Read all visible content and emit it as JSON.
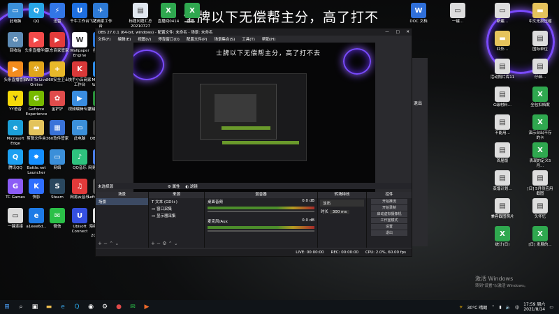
{
  "overlay": {
    "banner": "士牌以下无偿帮主分，高了打不",
    "banner_inner": "士牌以下无偿帮主分，高了打不去"
  },
  "desktop_left": [
    {
      "label": "此电脑",
      "color": "#3b8fd9",
      "glyph": "▭"
    },
    {
      "label": "QQ",
      "color": "#28a6e8",
      "glyph": "Q"
    },
    {
      "label": "迅雷",
      "color": "#3276e6",
      "glyph": "⚡"
    },
    {
      "label": "千牛工作台",
      "color": "#1e6fe0",
      "glyph": "U"
    },
    {
      "label": "飞猪商家工作台",
      "color": "#2d7ad6",
      "glyph": "✈"
    },
    {
      "label": "回收站",
      "color": "#5e8cb6",
      "glyph": "♻"
    },
    {
      "label": "头条直播伴侣",
      "color": "#f34a4a",
      "glyph": "▶"
    },
    {
      "label": "京东商家管家",
      "color": "#e33b3b",
      "glyph": "▶"
    },
    {
      "label": "Wallpaper Engine",
      "color": "#ffffff",
      "glyph": "W"
    },
    {
      "label": "控制面板",
      "color": "#2f79d8",
      "glyph": "▦"
    },
    {
      "label": "头条直播管家",
      "color": "#f28c1d",
      "glyph": "▶"
    },
    {
      "label": "Will To Live Online",
      "color": "#e0a51a",
      "glyph": "☢"
    },
    {
      "label": "360安全卫士",
      "color": "#e8b82a",
      "glyph": "+"
    },
    {
      "label": "快手小店商家工作台",
      "color": "#d93939",
      "glyph": "K"
    },
    {
      "label": "Microsoft Windows",
      "color": "#2e8be6",
      "glyph": "⊞"
    },
    {
      "label": "YY语音",
      "color": "#f5d90a",
      "glyph": "Y"
    },
    {
      "label": "GeForce Experience",
      "color": "#77b900",
      "glyph": "G"
    },
    {
      "label": "金铲铲",
      "color": "#e04c4c",
      "glyph": "✿"
    },
    {
      "label": "视频编辑专家",
      "color": "#3a8de0",
      "glyph": "▶"
    },
    {
      "label": "按键精灵2014",
      "color": "#2a8f3a",
      "glyph": "◎"
    },
    {
      "label": "Microsoft Edge",
      "color": "#1b9fd8",
      "glyph": "e"
    },
    {
      "label": "剪辑文件夹",
      "color": "#e3c35c",
      "glyph": "▬"
    },
    {
      "label": "360软件管家",
      "color": "#3a73d9",
      "glyph": "▦"
    },
    {
      "label": "此电脑",
      "color": "#3b8fd9",
      "glyph": "▭"
    },
    {
      "label": "OBS Studio",
      "color": "#3a3a3a",
      "glyph": "◉"
    },
    {
      "label": "腾讯QQ",
      "color": "#1da1f2",
      "glyph": "Q"
    },
    {
      "label": "Battle.net Launcher",
      "color": "#148eff",
      "glyph": "✸"
    },
    {
      "label": "网络",
      "color": "#3b8fd9",
      "glyph": "▭"
    },
    {
      "label": "QQ音乐",
      "color": "#2ec27e",
      "glyph": "♪"
    },
    {
      "label": "网易UU加速器",
      "color": "#4a7de6",
      "glyph": "U"
    },
    {
      "label": "TC Games",
      "color": "#8b5cf6",
      "glyph": "G"
    },
    {
      "label": "快影",
      "color": "#2f6fff",
      "glyph": "K"
    },
    {
      "label": "Steam",
      "color": "#2a475e",
      "glyph": "S"
    },
    {
      "label": "网易云音乐",
      "color": "#e23a3a",
      "glyph": "♫"
    },
    {
      "label": "Left 4 Dead 2",
      "color": "#555555",
      "glyph": "4"
    },
    {
      "label": "一键连接",
      "color": "#dddddd",
      "glyph": "▭"
    },
    {
      "label": "a1eee6d...",
      "color": "#1e7be6",
      "glyph": "e"
    },
    {
      "label": "微信",
      "color": "#2bc048",
      "glyph": "✉"
    },
    {
      "label": "Ubisoft Connect",
      "color": "#3550e0",
      "glyph": "U"
    },
    {
      "label": "海绵音游剪辑文件20210721",
      "color": "#dddddd",
      "glyph": "▤"
    }
  ],
  "desktop_top": [
    {
      "label": "标题问题汇总20210727",
      "color": "#dfe6ee",
      "glyph": "▤"
    },
    {
      "label": "直播间0414",
      "color": "#2fa84f",
      "glyph": "X"
    },
    {
      "label": "直播...",
      "color": "#2fa84f",
      "glyph": "X"
    },
    {
      "label": "DOC 文档",
      "color": "#2f6fd9",
      "glyph": "W"
    },
    {
      "label": "一键...",
      "color": "#dddddd",
      "glyph": "▭"
    }
  ],
  "desktop_right": [
    {
      "label": "新建...",
      "color": "#dddddd",
      "glyph": "▭"
    },
    {
      "label": "中文无损压缩",
      "color": "#e6c35c",
      "glyph": "▬"
    },
    {
      "label": "红外...",
      "color": "#e6c35c",
      "glyph": "▬"
    },
    {
      "label": "国际单位",
      "color": "#dddddd",
      "glyph": "▤"
    },
    {
      "label": "活动照片库11",
      "color": "#dddddd",
      "glyph": "▤"
    },
    {
      "label": "仔细...",
      "color": "#dddddd",
      "glyph": "▤"
    },
    {
      "label": "G级材料...",
      "color": "#dddddd",
      "glyph": "▤"
    },
    {
      "label": "全包扣档案",
      "color": "#2fa84f",
      "glyph": "X"
    },
    {
      "label": "不能用...",
      "color": "#dddddd",
      "glyph": "▤"
    },
    {
      "label": "演示台出不存的卡",
      "color": "#2fa84f",
      "glyph": "X"
    },
    {
      "label": "首届版",
      "color": "#dddddd",
      "glyph": "▤"
    },
    {
      "label": "表现的定义5月...",
      "color": "#2fa84f",
      "glyph": "X"
    },
    {
      "label": "蒸馏计划...",
      "color": "#dddddd",
      "glyph": "▤"
    },
    {
      "label": "[日] 5月份应用截图",
      "color": "#dddddd",
      "glyph": "▤"
    },
    {
      "label": "兼容截图照片",
      "color": "#dddddd",
      "glyph": "▤"
    },
    {
      "label": "头怀忆",
      "color": "#dddddd",
      "glyph": "▤"
    },
    {
      "label": "统计(日)",
      "color": "#2fa84f",
      "glyph": "X"
    },
    {
      "label": "[日] 发展的...",
      "color": "#2fa84f",
      "glyph": "X"
    }
  ],
  "obs": {
    "title": "OBS 27.0.1 (64-bit, windows) - 配置文件: 未命名 - 场景: 未命名",
    "menu": [
      "文件(F)",
      "编辑(E)",
      "视图(V)",
      "停靠窗口(D)",
      "配置文件(P)",
      "场景集合(S)",
      "工具(T)",
      "帮助(H)"
    ],
    "window_buttons": [
      "—",
      "□",
      "✕"
    ],
    "scenebar_label": "未选择源",
    "scenebar_tabs": [
      "属性",
      "滤镜"
    ],
    "docks": {
      "scenes_header": "场景",
      "scenes": [
        "场景"
      ],
      "sources_header": "来源",
      "sources": [
        "文本 (GDI+)",
        "窗口采集",
        "显示器采集"
      ],
      "mixer_header": "混音器",
      "mixer_tracks": [
        {
          "name": "桌面音频",
          "db": "0.0 dB"
        },
        {
          "name": "麦克风/Aux",
          "db": "0.0 dB"
        }
      ],
      "transitions_header": "转场特效",
      "transition_type": "淡出",
      "duration_label": "时长",
      "duration_value": "300 ms",
      "controls_header": "控件",
      "controls": [
        "开始推流",
        "开始录制",
        "启动虚拟摄像机",
        "工作室模式",
        "设置",
        "退出"
      ]
    },
    "status": {
      "live": "LIVE: 00:00:00",
      "rec": "REC: 00:00:00",
      "cpu": "CPU: 2.0%, 60.00 fps"
    }
  },
  "sidepanel_label": "退出",
  "activation": {
    "title": "激活 Windows",
    "sub": "转到\"设置\"以激活 Windows。"
  },
  "taskbar": {
    "search_placeholder": "",
    "temperature": "30°C 晴朗",
    "time": "17:59 周六",
    "date": "2021/8/14",
    "lang": "中"
  }
}
